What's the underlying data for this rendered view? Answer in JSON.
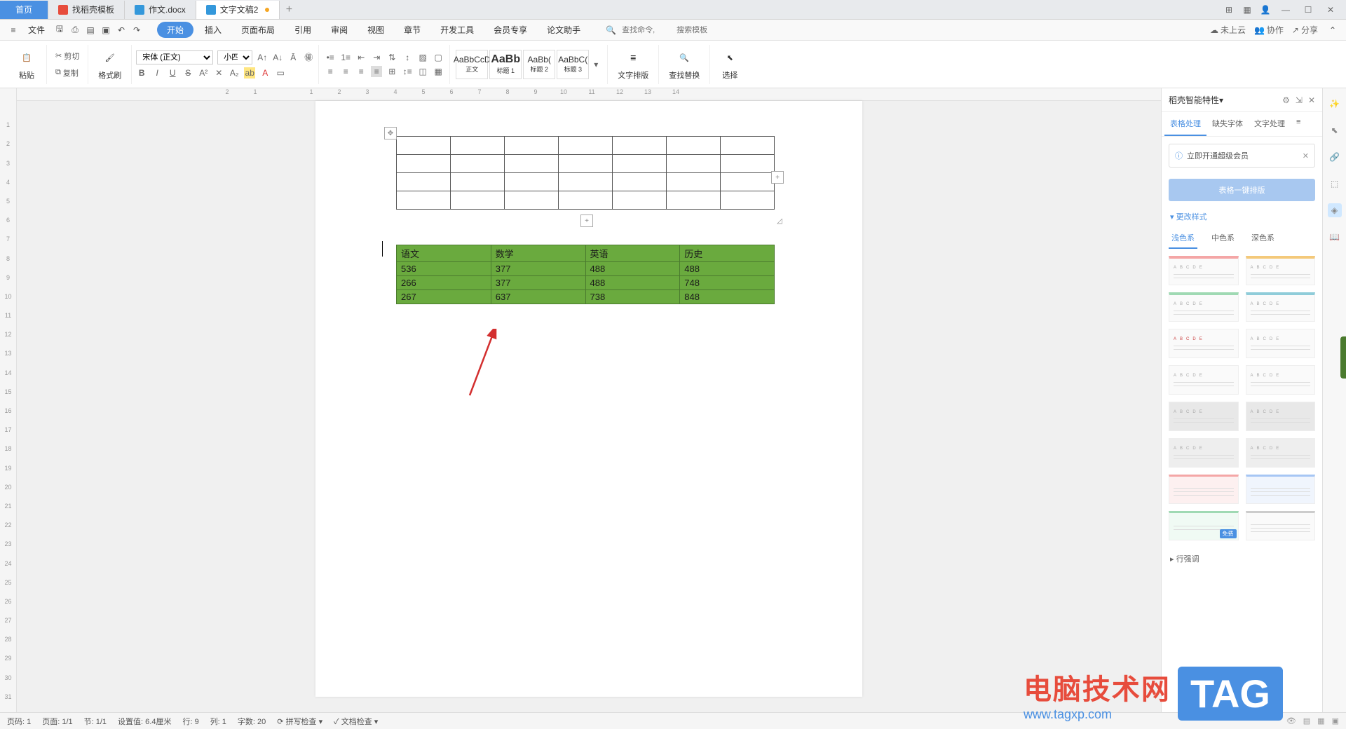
{
  "titlebar": {
    "tabs": [
      {
        "label": "首页",
        "kind": "home"
      },
      {
        "label": "找稻壳模板",
        "kind": "template"
      },
      {
        "label": "作文.docx",
        "kind": "doc"
      },
      {
        "label": "文字文稿2",
        "kind": "doc-active"
      }
    ],
    "win_icons": {
      "minimize": "—",
      "maximize": "☐",
      "close": "✕"
    }
  },
  "menubar": {
    "file": "文件",
    "items": [
      "开始",
      "插入",
      "页面布局",
      "引用",
      "审阅",
      "视图",
      "章节",
      "开发工具",
      "会员专享",
      "论文助手"
    ],
    "search_placeholder": "查找命令,",
    "template_search": "搜索模板",
    "right": {
      "cloud": "未上云",
      "coop": "协作",
      "share": "分享"
    }
  },
  "ribbon": {
    "paste": "粘贴",
    "cut": "剪切",
    "copy": "复制",
    "format_painter": "格式刷",
    "font_name": "宋体 (正文)",
    "font_size": "小四",
    "styles": [
      {
        "preview": "AaBbCcD",
        "name": "正文"
      },
      {
        "preview": "AaBb",
        "name": "标题 1"
      },
      {
        "preview": "AaBb(",
        "name": "标题 2"
      },
      {
        "preview": "AaBbC(",
        "name": "标题 3"
      }
    ],
    "text_layout": "文字排版",
    "find_replace": "查找替换",
    "select": "选择"
  },
  "chart_data": {
    "type": "table",
    "headers": [
      "语文",
      "数学",
      "英语",
      "历史"
    ],
    "rows": [
      [
        "536",
        "377",
        "488",
        "488"
      ],
      [
        "266",
        "377",
        "488",
        "748"
      ],
      [
        "267",
        "637",
        "738",
        "848"
      ]
    ]
  },
  "right_panel": {
    "title": "稻壳智能特性",
    "tabs": [
      "表格处理",
      "缺失字体",
      "文字处理"
    ],
    "info_text": "立即开通超级会员",
    "btn_label": "表格一键排版",
    "section_change": "更改样式",
    "section_row": "行强调",
    "color_tabs": [
      "浅色系",
      "中色系",
      "深色系"
    ],
    "style_header_letters": [
      "A",
      "B",
      "C",
      "D",
      "E"
    ],
    "free_badge": "免费"
  },
  "statusbar": {
    "page_code": "页码: 1",
    "page": "页面: 1/1",
    "section": "节: 1/1",
    "position": "设置值: 6.4厘米",
    "row": "行: 9",
    "col": "列: 1",
    "word_count": "字数: 20",
    "spell": "拼写检查",
    "doc_check": "文档检查"
  },
  "watermark": {
    "text": "电脑技术网",
    "url": "www.tagxp.com",
    "tag": "TAG"
  },
  "icons": {
    "hamburger": "≡",
    "save": "🖫",
    "print": "⎙",
    "preview": "▤",
    "undo": "↶",
    "redo": "↷",
    "bold": "B",
    "italic": "I",
    "underline": "U",
    "strike": "S",
    "superscript": "A",
    "gear": "⚙",
    "pin": "📌",
    "close_panel": "✕",
    "info": "ⓘ",
    "arrow_down": "▾",
    "search": "🔍"
  }
}
